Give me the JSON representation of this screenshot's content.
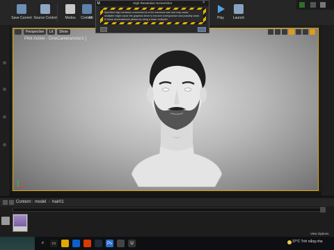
{
  "toolbar": {
    "buttons": [
      {
        "label": "Save Current"
      },
      {
        "label": "Source Control"
      },
      {
        "label": "Modes"
      },
      {
        "label": "Content"
      },
      {
        "label": "M"
      },
      {
        "label": "Play"
      },
      {
        "label": "Launch"
      }
    ]
  },
  "dialog": {
    "title": "High Resolution Screenshot",
    "logo": "U",
    "close": "×",
    "message_lines": [
      "Specified high resolution screenshot is of the maximum size and may cause",
      "multiplier might cause the graphics driver to become unresponsive and possibly crash.",
      "In these circumstances please try using a lower multiplier."
    ]
  },
  "viewport": {
    "chips": [
      "Perspective",
      "Lit",
      "Show"
    ],
    "pilot_text": "Pilot Active - CineCameraActor1 ]"
  },
  "content_browser": {
    "breadcrumbs": [
      "Content",
      "model",
      "hair01"
    ],
    "view_options": "View Options"
  },
  "taskbar": {
    "weather": "37°C  Trời nắng nhẹ"
  },
  "colors": {
    "accent": "#e1a800",
    "toolbar_bg": "#262626",
    "dialog_stripe": "#e1b400"
  }
}
